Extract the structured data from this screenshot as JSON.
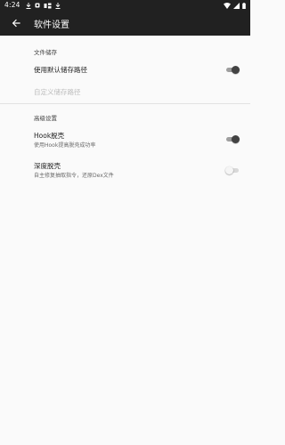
{
  "status_bar": {
    "time": "4:24",
    "left_icons": [
      "download-icon",
      "download-icon",
      "record-icon",
      "notification-app-icon",
      "download-icon"
    ],
    "right_icons": [
      "wifi-icon",
      "signal-icon",
      "battery-icon"
    ]
  },
  "app_bar": {
    "back_icon": "arrow-back-icon",
    "title": "软件设置"
  },
  "sections": {
    "storage": {
      "header": "文件储存",
      "use_default_path": {
        "title": "使用默认储存路径",
        "switch_on": true
      },
      "custom_path": {
        "title": "自定义储存路径",
        "enabled": false
      }
    },
    "advanced": {
      "header": "高级设置",
      "hook_unpack": {
        "title": "Hook脱壳",
        "summary": "使用Hook提高脱壳成功率",
        "switch_on": true
      },
      "deep_unpack": {
        "title": "深度脱壳",
        "summary": "自主修复抽取指令，还原Dex文件",
        "switch_on": false
      }
    }
  },
  "colors": {
    "app_bar": "#212121",
    "background": "#fafafa",
    "switch_on_thumb": "#424242",
    "disabled_text": "#bdbdbd"
  }
}
